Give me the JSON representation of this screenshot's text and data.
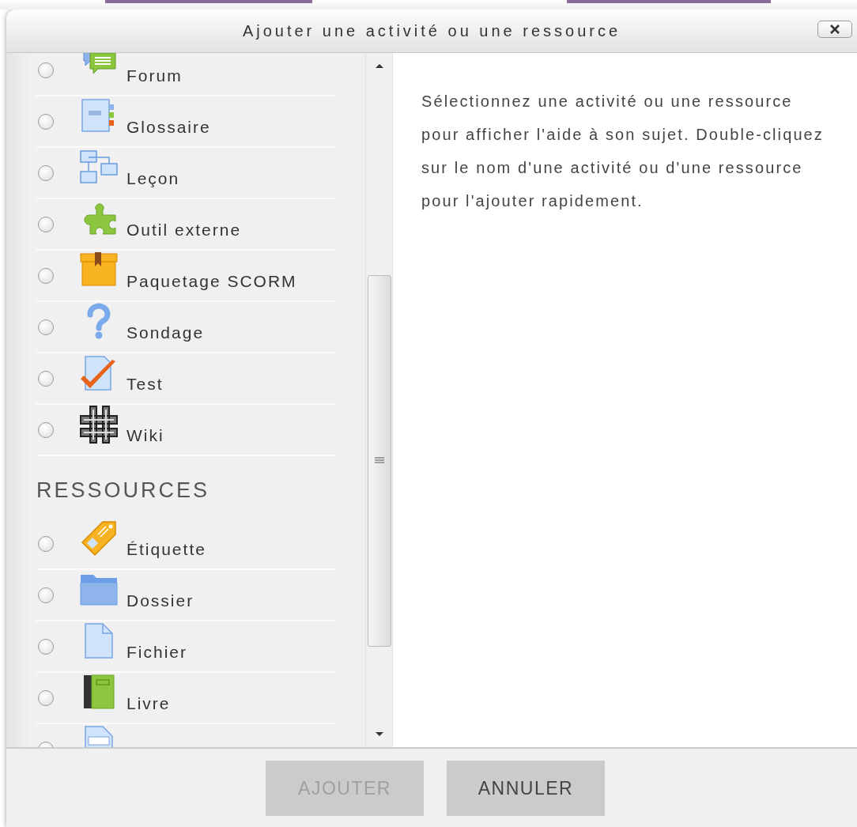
{
  "dialog": {
    "title": "Ajouter une activité ou une ressource"
  },
  "sections": [
    {
      "items": [
        {
          "label": "Forum",
          "kind": "forum",
          "selected": false
        },
        {
          "label": "Glossaire",
          "kind": "glossary",
          "selected": false
        },
        {
          "label": "Leçon",
          "kind": "lesson",
          "selected": false
        },
        {
          "label": "Outil externe",
          "kind": "tool",
          "selected": false
        },
        {
          "label": "Paquetage SCORM",
          "kind": "scorm",
          "selected": false
        },
        {
          "label": "Sondage",
          "kind": "survey",
          "selected": false
        },
        {
          "label": "Test",
          "kind": "quiz",
          "selected": false
        },
        {
          "label": "Wiki",
          "kind": "wiki",
          "selected": false
        }
      ]
    },
    {
      "heading": "RESSOURCES",
      "items": [
        {
          "label": "Étiquette",
          "kind": "label",
          "selected": false
        },
        {
          "label": "Dossier",
          "kind": "folder",
          "selected": false
        },
        {
          "label": "Fichier",
          "kind": "file",
          "selected": false
        },
        {
          "label": "Livre",
          "kind": "book",
          "selected": false
        },
        {
          "kind": "page",
          "selected": false
        }
      ]
    }
  ],
  "help": "Sélectionnez une activité ou une ressource pour afficher l'aide à son sujet. Double-cliquez sur le nom d'une activité ou d'une ressource pour l'ajouter rapidement.",
  "buttons": [
    {
      "label": "AJOUTER",
      "disabled": true
    },
    {
      "label": "ANNULER",
      "disabled": false
    }
  ]
}
